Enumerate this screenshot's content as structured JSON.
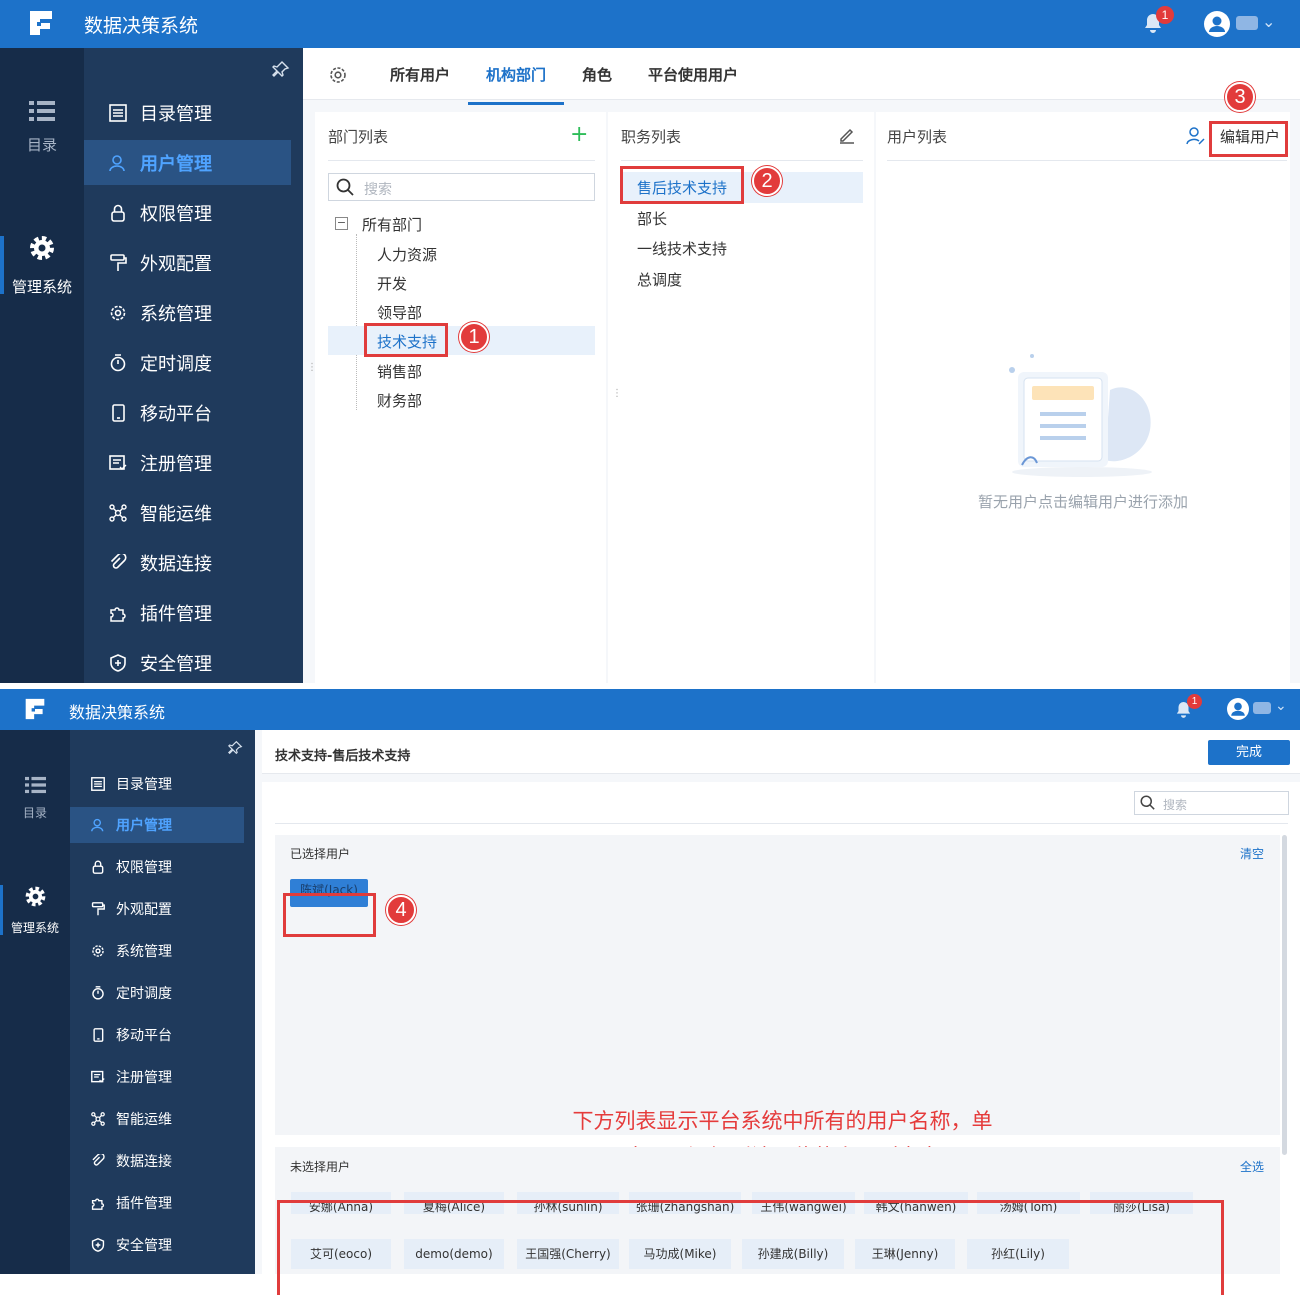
{
  "app": {
    "title": "数据决策系统",
    "notification_count": "1"
  },
  "rail": {
    "catalog_label": "目录",
    "admin_label": "管理系统"
  },
  "nav": {
    "items": [
      {
        "label": "目录管理"
      },
      {
        "label": "用户管理"
      },
      {
        "label": "权限管理"
      },
      {
        "label": "外观配置"
      },
      {
        "label": "系统管理"
      },
      {
        "label": "定时调度"
      },
      {
        "label": "移动平台"
      },
      {
        "label": "注册管理"
      },
      {
        "label": "智能运维"
      },
      {
        "label": "数据连接"
      },
      {
        "label": "插件管理"
      },
      {
        "label": "安全管理"
      }
    ]
  },
  "tabs": [
    {
      "label": "所有用户"
    },
    {
      "label": "机构部门"
    },
    {
      "label": "角色"
    },
    {
      "label": "平台使用用户"
    }
  ],
  "dept_panel": {
    "title": "部门列表",
    "search_placeholder": "搜索",
    "root": "所有部门",
    "children": [
      "人力资源",
      "开发",
      "领导部",
      "技术支持",
      "销售部",
      "财务部"
    ]
  },
  "duty_panel": {
    "title": "职务列表",
    "items": [
      "售后技术支持",
      "部长",
      "一线技术支持",
      "总调度"
    ]
  },
  "user_panel": {
    "title": "用户列表",
    "edit_label": "编辑用户",
    "empty_text": "暂无用户点击编辑用户进行添加"
  },
  "callouts": {
    "c1": "1",
    "c2": "2",
    "c3": "3",
    "c4": "4"
  },
  "screen2": {
    "breadcrumb": "技术支持-售后技术支持",
    "done_label": "完成",
    "search_placeholder": "搜索",
    "selected_title": "已选择用户",
    "clear_label": "清空",
    "selected_users": [
      "陈斌(Jack)"
    ],
    "unselected_title": "未选择用户",
    "select_all_label": "全选",
    "users_row1": [
      "安娜(Anna)",
      "夏梅(Alice)",
      "孙林(sunlin)",
      "张珊(zhangshan)",
      "王伟(wangwei)",
      "韩文(hanwen)",
      "汤姆(Tom)",
      "丽莎(Lisa)"
    ],
    "users_row2": [
      "艾可(eoco)",
      "demo(demo)",
      "王国强(Cherry)",
      "马功成(Mike)",
      "孙建成(Billy)",
      "王琳(Jenny)",
      "孙红(Lily)"
    ],
    "note_line1": "下方列表显示平台系统中所有的用户名称，单",
    "note_line2": "击即可添加到该职位的人员列表中"
  },
  "colors": {
    "brand": "#1d72c9",
    "sidebar_dark": "#162c49",
    "sidebar": "#1f3a5c",
    "highlight": "#e03c3c"
  }
}
